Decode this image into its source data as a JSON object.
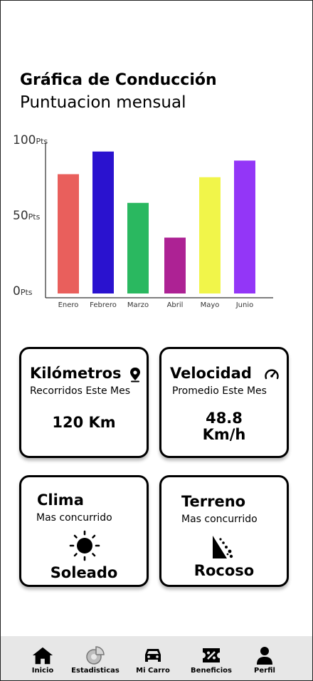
{
  "header": {
    "title": "Gráfica de Conducción",
    "subtitle": "Puntuacion mensual"
  },
  "chart_data": {
    "type": "bar",
    "categories": [
      "Enero",
      "Febrero",
      "Marzo",
      "Abril",
      "Mayo",
      "Junio"
    ],
    "values": [
      79,
      94,
      60,
      37,
      77,
      88
    ],
    "colors": [
      "#e95f5c",
      "#2a12cf",
      "#2ab860",
      "#ad2294",
      "#f1f54a",
      "#9336f7"
    ],
    "ylim": [
      0,
      100
    ],
    "yticks": [
      {
        "value": 100,
        "label": "100",
        "unit": "Pts"
      },
      {
        "value": 50,
        "label": "50",
        "unit": "Pts"
      },
      {
        "value": 0,
        "label": "0",
        "unit": "Pts"
      }
    ]
  },
  "cards": {
    "kilometros": {
      "title": "Kilómetros",
      "sub": "Recorridos Este Mes",
      "value": "120 Km",
      "icon": "location-pin-icon"
    },
    "velocidad": {
      "title": "Velocidad",
      "sub": "Promedio Este Mes",
      "value_line1": "48.8",
      "value_line2": "Km/h",
      "icon": "speedometer-icon"
    },
    "clima": {
      "title": "Clima",
      "sub": "Mas concurrido",
      "value": "Soleado",
      "icon": "sun-icon"
    },
    "terreno": {
      "title": "Terreno",
      "sub": "Mas concurrido",
      "value": "Rocoso",
      "icon": "landslide-icon"
    }
  },
  "nav": {
    "items": [
      {
        "label": "Inicio",
        "icon": "home-icon"
      },
      {
        "label": "Estadisticas",
        "icon": "chart-pie-icon"
      },
      {
        "label": "Mi Carro",
        "icon": "car-icon"
      },
      {
        "label": "Beneficios",
        "icon": "ticket-icon"
      },
      {
        "label": "Perfil",
        "icon": "user-icon"
      }
    ]
  }
}
